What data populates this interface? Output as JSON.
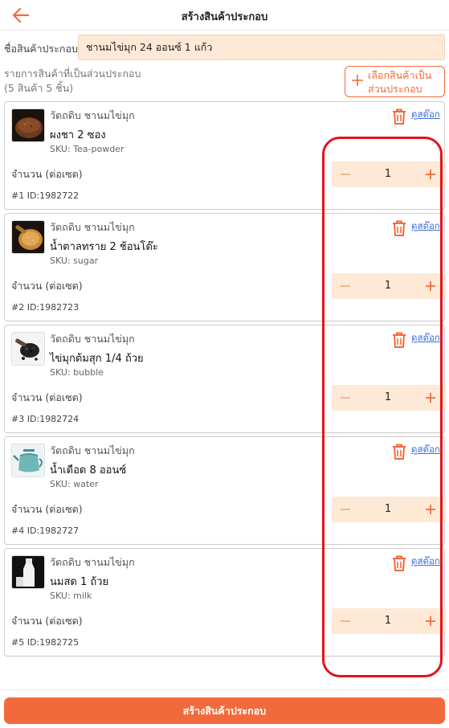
{
  "header": {
    "title": "สร้างสินค้าประกอบ",
    "back_icon": "arrow-left-icon"
  },
  "bundle_name": {
    "label": "ชื่อสินค้าประกอบ",
    "value": "ชานมไข่มุก 24 ออนซ์ 1 แก้ว"
  },
  "list_header": {
    "title": "รายการสินค้าที่เป็นส่วนประกอบ",
    "count": "(5 สินค้า 5 ชิ้น)",
    "select_button": {
      "line1": "เลือกสินค้าเป็น",
      "line2": "ส่วนประกอบ"
    }
  },
  "items": [
    {
      "category": "วัตถดิบ ชานมไข่มุก",
      "name": "ผงชา 2 ซอง",
      "sku": "SKU: Tea-powder",
      "qty_label": "จำนวน (ต่อเซต)",
      "qty": "1",
      "id_text": "#1 ID:1982722",
      "stock_link": "ดูสต๊อก",
      "image": "tea-powder-image"
    },
    {
      "category": "วัตถดิบ ชานมไข่มุก",
      "name": "น้ำตาลทราย 2 ช้อนโต๊ะ",
      "sku": "SKU: sugar",
      "qty_label": "จำนวน (ต่อเซต)",
      "qty": "1",
      "id_text": "#2 ID:1982723",
      "stock_link": "ดูสต๊อก",
      "image": "sugar-image"
    },
    {
      "category": "วัตถดิบ ชานมไข่มุก",
      "name": "ไข่มุกต้มสุก 1/4 ถ้วย",
      "sku": "SKU: bubble",
      "qty_label": "จำนวน (ต่อเซต)",
      "qty": "1",
      "id_text": "#3 ID:1982724",
      "stock_link": "ดูสต๊อก",
      "image": "bubble-image"
    },
    {
      "category": "วัตถดิบ ชานมไข่มุก",
      "name": "น้ำเดือด 8 ออนซ์",
      "sku": "SKU: water",
      "qty_label": "จำนวน (ต่อเซต)",
      "qty": "1",
      "id_text": "#4 ID:1982727",
      "stock_link": "ดูสต๊อก",
      "image": "kettle-image"
    },
    {
      "category": "วัตถดิบ ชานมไข่มุก",
      "name": "นมสด 1 ถ้วย",
      "sku": "SKU: milk",
      "qty_label": "จำนวน (ต่อเซต)",
      "qty": "1",
      "id_text": "#5 ID:1982725",
      "stock_link": "ดูสต๊อก",
      "image": "milk-image"
    }
  ],
  "footer": {
    "create_label": "สร้างสินค้าประกอบ"
  },
  "colors": {
    "accent": "#f26a3c",
    "input_bg": "#fde9d6",
    "link": "#3a6fd8",
    "highlight": "#e2141c"
  }
}
